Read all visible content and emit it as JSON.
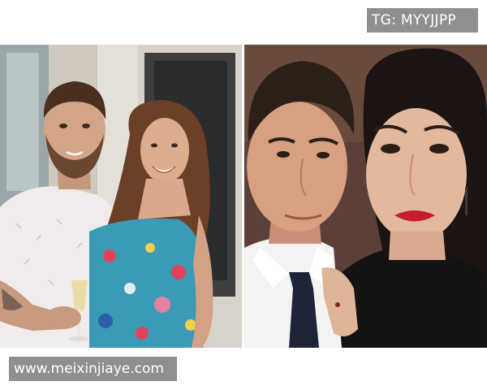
{
  "watermarks": {
    "top_right": "TG: MYYJJPP",
    "bottom_left": "www.meixinjiaye.com"
  },
  "photos": [
    {
      "subject": "couple-selfie-indoor-with-champagne"
    },
    {
      "subject": "couple-selfie-close-up"
    }
  ],
  "colors": {
    "background": "#ffffff",
    "watermark_bg": "#8f8f8f",
    "watermark_text": "#ffffff"
  }
}
